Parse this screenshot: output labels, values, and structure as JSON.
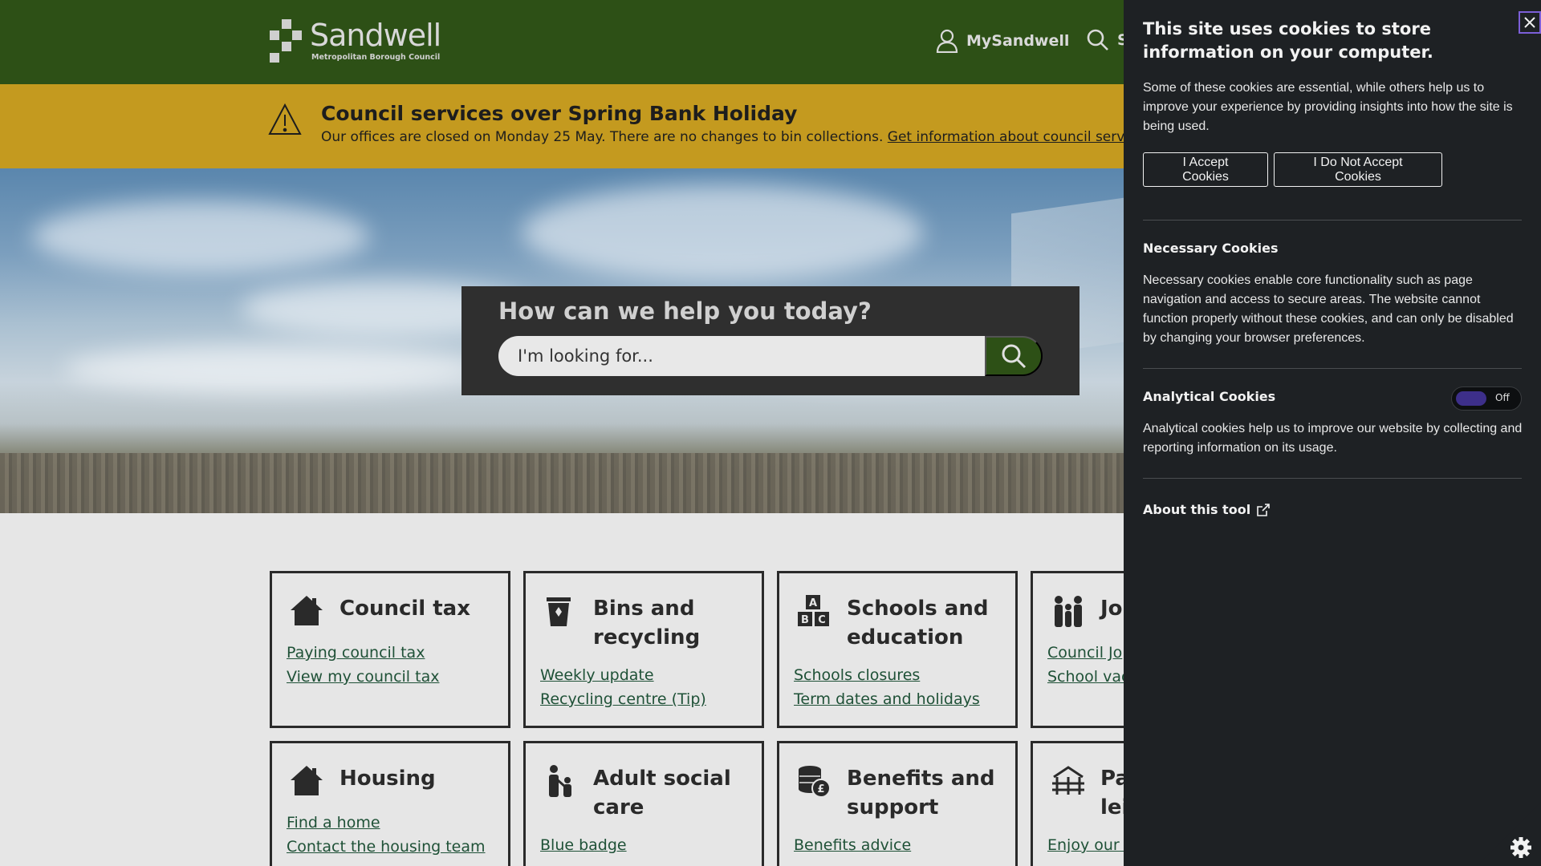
{
  "header": {
    "logo_name": "Sandwell",
    "logo_sub": "Metropolitan Borough Council",
    "my_account": "MySandwell",
    "search_label": "S"
  },
  "alert": {
    "title": "Council services over Spring Bank Holiday",
    "body": "Our offices are closed on Monday 25 May. There are no changes to bin collections.",
    "link": "Get information about council services ov"
  },
  "hero": {
    "question": "How can we help you today?",
    "placeholder": "I'm looking for..."
  },
  "cards": [
    {
      "title": "Council tax",
      "icon": "house-icon",
      "links": [
        "Paying council tax",
        "View my council tax"
      ]
    },
    {
      "title": "Bins and recycling",
      "icon": "bin-icon",
      "links": [
        "Weekly update",
        "Recycling centre (Tip)"
      ]
    },
    {
      "title": "Schools and education",
      "icon": "abc-blocks-icon",
      "links": [
        "Schools closures",
        "Term dates and holidays"
      ]
    },
    {
      "title": "Jo",
      "icon": "people-icon",
      "links": [
        "Council Jo",
        "School vac"
      ]
    },
    {
      "title": "Housing",
      "icon": "house-icon",
      "links": [
        "Find a home",
        "Contact the housing team"
      ]
    },
    {
      "title": "Adult social care",
      "icon": "carer-icon",
      "links": [
        "Blue badge",
        ""
      ]
    },
    {
      "title": "Benefits and support",
      "icon": "coins-icon",
      "links": [
        "Benefits advice",
        ""
      ]
    },
    {
      "title": "Pa lei",
      "icon": "park-icon",
      "links": [
        "Enjoy our p",
        ""
      ]
    }
  ],
  "cookies": {
    "title": "This site uses cookies to store information on your computer.",
    "intro": "Some of these cookies are essential, while others help us to improve your experience by providing insights into how the site is being used.",
    "accept": "I Accept Cookies",
    "reject": "I Do Not Accept Cookies",
    "necessary_title": "Necessary Cookies",
    "necessary_body": "Necessary cookies enable core functionality such as page navigation and access to secure areas. The website cannot function properly without these cookies, and can only be disabled by changing your browser preferences.",
    "analytical_title": "Analytical Cookies",
    "analytical_toggle": "Off",
    "analytical_body": "Analytical cookies help us to improve our website by collecting and reporting information on its usage.",
    "about": "About this tool"
  },
  "colors": {
    "header": "#2d5016",
    "alert": "#c49a1f",
    "link": "#1f5137",
    "panel": "#1e2124",
    "toggle": "#3d2f8a"
  }
}
